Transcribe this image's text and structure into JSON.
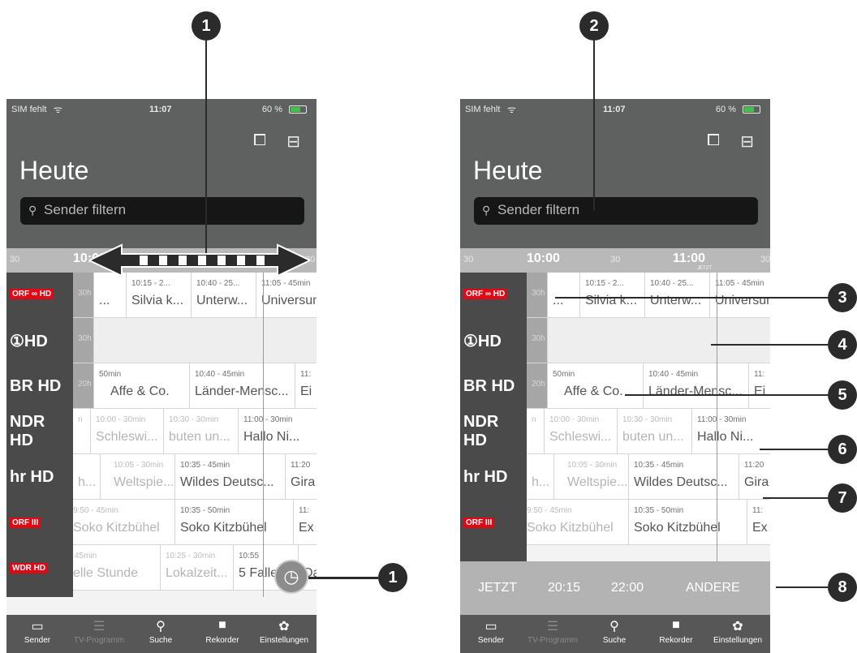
{
  "status": {
    "carrier": "SIM fehlt",
    "wifi": "ᯤ",
    "time": "11:07",
    "battery": "60 %"
  },
  "header": {
    "title": "Heute",
    "search_placeholder": "Sender filtern",
    "search_icon": "⚲",
    "tv_icon": "⧠",
    "radio_icon": "⊟"
  },
  "timeline": {
    "t1": "30",
    "t2": "10:00",
    "t3": "30",
    "t4": "11:00",
    "t5": "30",
    "now_label": "JETZT"
  },
  "channels": [
    {
      "name": "ORF ∞ HD"
    },
    {
      "name": "①HD"
    },
    {
      "name": "BR HD"
    },
    {
      "name": "NDR HD"
    },
    {
      "name": "hr HD"
    },
    {
      "name": "ORF III"
    },
    {
      "name": "WDR HD"
    }
  ],
  "rows": [
    {
      "cells": [
        {
          "time": "30h",
          "prog": "",
          "kind": "dim"
        },
        {
          "time": "",
          "prog": "...",
          "kind": "normal"
        },
        {
          "time": "10:15 - 2...",
          "prog": "Silvia k...",
          "kind": "normal"
        },
        {
          "time": "10:40 - 25...",
          "prog": "Unterw...",
          "kind": "normal"
        },
        {
          "time": "11:05 - 45min",
          "prog": "Universum",
          "kind": "normal"
        }
      ]
    },
    {
      "cells": [
        {
          "time": "30h",
          "prog": "",
          "kind": "dim"
        },
        {
          "time": "",
          "prog": "",
          "kind": "empty"
        }
      ]
    },
    {
      "cells": [
        {
          "time": "20h",
          "prog": "",
          "kind": "dim"
        },
        {
          "time": "50min",
          "prog": "Affe & Co.",
          "kind": "normal"
        },
        {
          "time": "10:40 - 45min",
          "prog": "Länder-Mensc...",
          "kind": "normal"
        },
        {
          "time": "11:",
          "prog": "Ei",
          "kind": "normal"
        }
      ]
    },
    {
      "cells": [
        {
          "time": "n",
          "prog": "",
          "kind": "faded"
        },
        {
          "time": "10:00 - 30min",
          "prog": "Schleswi...",
          "kind": "faded"
        },
        {
          "time": "10:30 - 30min",
          "prog": "buten un...",
          "kind": "faded"
        },
        {
          "time": "11:00 - 30min",
          "prog": "Hallo Ni...",
          "kind": "normal"
        }
      ]
    },
    {
      "cells": [
        {
          "time": "",
          "prog": "h...",
          "kind": "faded"
        },
        {
          "time": "10:05 - 30min",
          "prog": "Weltspie...",
          "kind": "faded"
        },
        {
          "time": "10:35 - 45min",
          "prog": "Wildes Deutsc...",
          "kind": "normal"
        },
        {
          "time": "11:20",
          "prog": "Gira",
          "kind": "normal"
        }
      ]
    },
    {
      "cells": [
        {
          "time": "9:50 - 45min",
          "prog": "Soko Kitzbühel",
          "kind": "faded"
        },
        {
          "time": "10:35 - 50min",
          "prog": "Soko Kitzbühel",
          "kind": "normal"
        },
        {
          "time": "11:",
          "prog": "Ex",
          "kind": "normal"
        }
      ]
    },
    {
      "cells": [
        {
          "time": "45min",
          "prog": "elle Stunde",
          "kind": "faded"
        },
        {
          "time": "10:25 - 30min",
          "prog": "Lokalzeit...",
          "kind": "faded"
        },
        {
          "time": "10:55",
          "prog": "5 Fallen...",
          "kind": "normal"
        },
        {
          "time": "",
          "prog": "Da",
          "kind": "normal"
        }
      ]
    }
  ],
  "quick": {
    "now": "JETZT",
    "t2015": "20:15",
    "t2200": "22:00",
    "other": "ANDERE"
  },
  "tabs": [
    {
      "icon": "▭",
      "label": "Sender",
      "active": true
    },
    {
      "icon": "☰",
      "label": "TV-Programm",
      "active": false
    },
    {
      "icon": "⚲",
      "label": "Suche",
      "active": true
    },
    {
      "icon": "■",
      "label": "Rekorder",
      "active": true
    },
    {
      "icon": "✿",
      "label": "Einstellungen",
      "active": true
    }
  ],
  "fab_icon": "◷",
  "callouts": {
    "c1": "1",
    "c2": "2",
    "c3": "3",
    "c4": "4",
    "c5": "5",
    "c6": "6",
    "c7": "7",
    "c8": "8"
  }
}
